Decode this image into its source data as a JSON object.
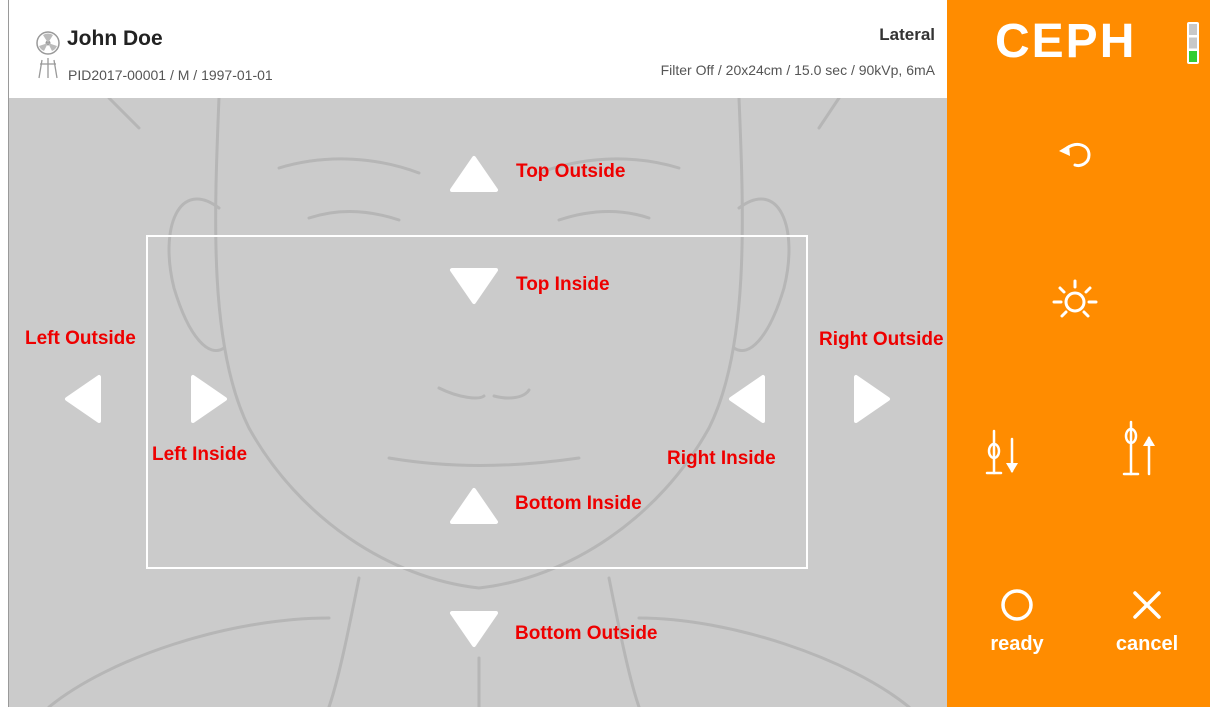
{
  "header": {
    "patient_name": "John Doe",
    "patient_info": "PID2017-00001 / M / 1997-01-01",
    "mode": "Lateral",
    "exposure": "Filter Off / 20x24cm / 15.0 sec / 90kVp, 6mA"
  },
  "arrows": {
    "top_outside": "Top Outside",
    "top_inside": "Top Inside",
    "left_outside": "Left Outside",
    "left_inside": "Left Inside",
    "right_outside": "Right Outside",
    "right_inside": "Right Inside",
    "bottom_inside": "Bottom Inside",
    "bottom_outside": "Bottom Outside"
  },
  "panel": {
    "title": "CEPH",
    "ready_label": "ready",
    "cancel_label": "cancel",
    "status_lights": [
      "#c8c8c8",
      "#c8c8c8",
      "#32cd32"
    ]
  },
  "colors": {
    "accent": "#ff8c00",
    "annotation": "#ee0000",
    "canvas": "#cbcbcb"
  },
  "icons": {
    "back": "undo-icon",
    "light": "light-bulb-icon",
    "ear_rod_down": "ear-rod-down-icon",
    "ear_rod_up": "ear-rod-up-icon",
    "ready": "circle-icon",
    "cancel": "close-icon",
    "patient": "patient-radiation-icon"
  }
}
